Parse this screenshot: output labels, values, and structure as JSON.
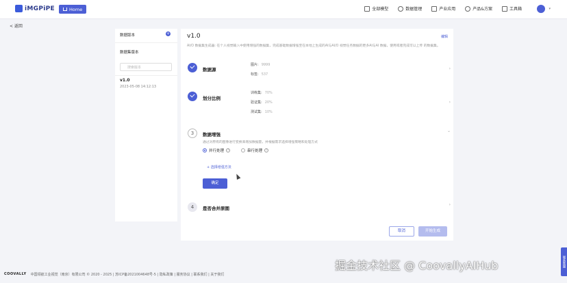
{
  "header": {
    "logo_text": "iMGPiPE",
    "home_label": "Home",
    "nav": [
      {
        "label": "全部模型",
        "icon": "grid-icon"
      },
      {
        "label": "数据管理",
        "icon": "database-icon"
      },
      {
        "label": "产业应用",
        "icon": "factory-icon"
      },
      {
        "label": "产品&方案",
        "icon": "shield-icon"
      },
      {
        "label": "工具箱",
        "icon": "toolbox-icon"
      }
    ]
  },
  "back_label": "< 返回",
  "left_panel": {
    "data_version_label": "数据版本",
    "data_set_version_label": "数据集版本",
    "search_placeholder": "搜索版本",
    "version": "v1.0",
    "version_date": "2023-05-08 14:12:13"
  },
  "main": {
    "title": "v1.0",
    "edit_label": "编辑",
    "description": "AI/O 数据集生成器: 在个人视觉输入中使用增强的数据集，完成基础数据增强至在本地上生成的AI与AI/O 视觉任务数据的更多AI与AI 数据，使用或者完成可以上传 的数据集。",
    "steps": [
      {
        "title": "数据源",
        "kv": [
          {
            "k": "图片:",
            "v": "9999"
          },
          {
            "k": "标签:",
            "v": "537"
          }
        ]
      },
      {
        "title": "划分比例",
        "kv": [
          {
            "k": "训练集:",
            "v": "70%"
          },
          {
            "k": "验证集:",
            "v": "20%"
          },
          {
            "k": "测试集:",
            "v": "10%"
          }
        ]
      },
      {
        "num": "3",
        "title": "数据增强",
        "desc": "通过对原有的图像进行变换来增加数据量，并根据需求选择增强策略和处理方式",
        "opt_parallel": "并行处理",
        "opt_serial": "串行处理",
        "add_label": "+ 选择增强方法",
        "apply_label": "确定"
      },
      {
        "num": "4",
        "title": "是否合并原图"
      }
    ]
  },
  "actions": {
    "cancel_label": "取消",
    "start_label": "开始生成"
  },
  "footer": {
    "brand": "COOVALLY",
    "text": "中国领航工业视觉（南京）有限公司 © 2020 - 2025 | 苏ICP备2021004648号-5 | 隐私政策 | 服务协议 | 联系我们 | 关于我们"
  },
  "watermark": "掘金技术社区 @ CoovallyAIHub",
  "side_tab_label": "联系客服",
  "colors": {
    "accent": "#4c5fd5",
    "accent_light": "#b4bcee",
    "background": "#f3f4f8"
  }
}
